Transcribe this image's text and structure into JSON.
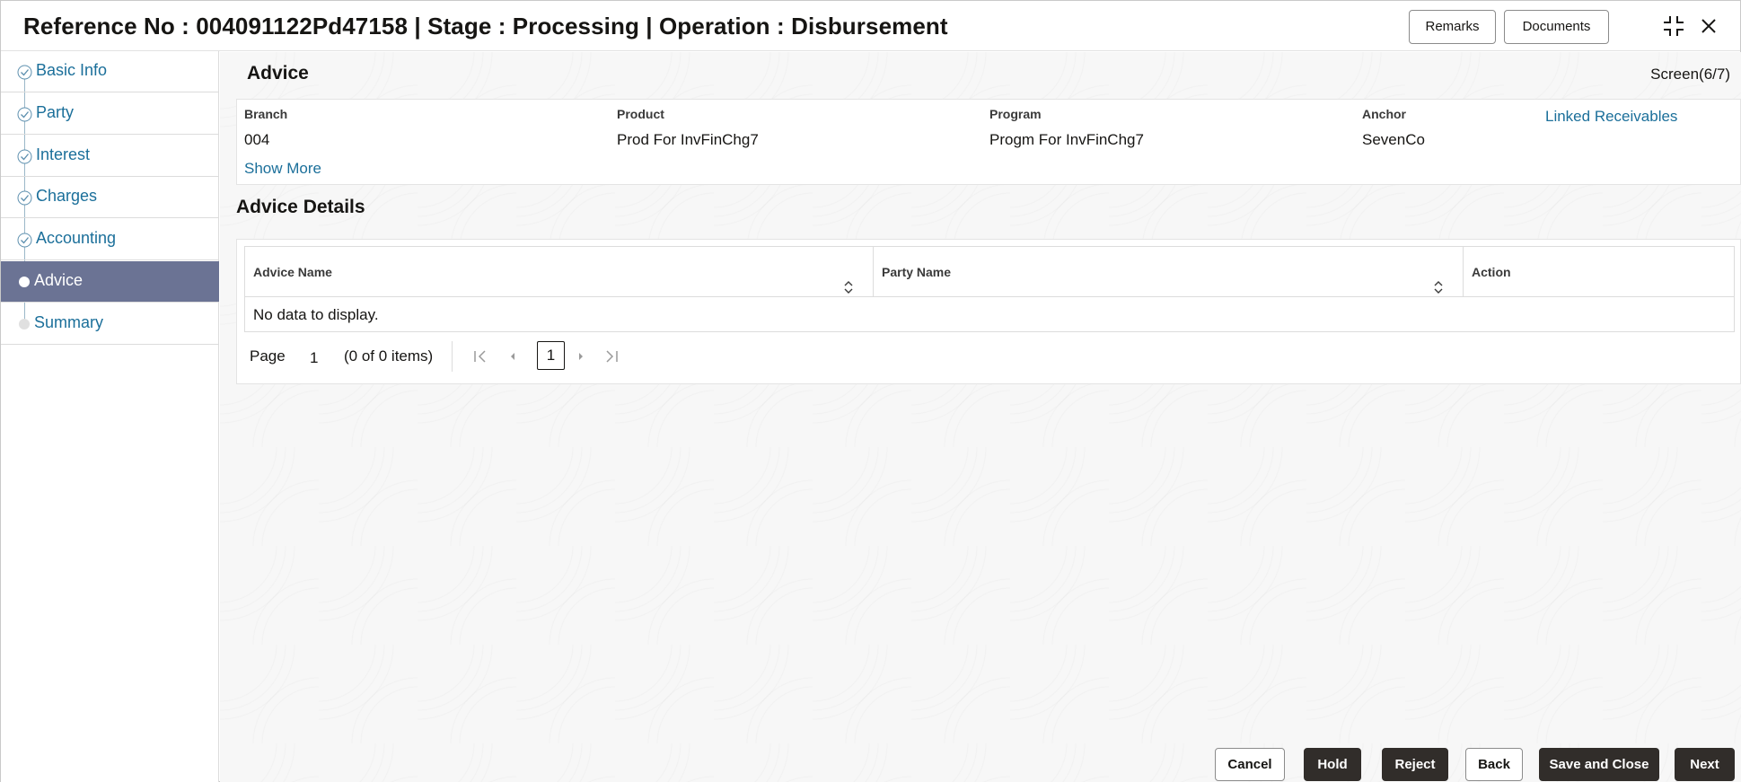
{
  "header": {
    "title": "Reference No : 004091122Pd47158 | Stage : Processing | Operation : Disbursement",
    "remarks_label": "Remarks",
    "documents_label": "Documents",
    "compress_icon": "compress-icon",
    "close_icon": "close-icon"
  },
  "sidebar": {
    "items": [
      {
        "label": "Basic Info",
        "state": "done"
      },
      {
        "label": "Party",
        "state": "done"
      },
      {
        "label": "Interest",
        "state": "done"
      },
      {
        "label": "Charges",
        "state": "done"
      },
      {
        "label": "Accounting",
        "state": "done"
      },
      {
        "label": "Advice",
        "state": "active"
      },
      {
        "label": "Summary",
        "state": "pending"
      }
    ],
    "active_color": "#6b7394"
  },
  "main": {
    "title": "Advice",
    "screen_count": "Screen(6/7)",
    "info": {
      "branch_label": "Branch",
      "branch_value": "004",
      "product_label": "Product",
      "product_value": "Prod For InvFinChg7",
      "program_label": "Program",
      "program_value": "Progm For InvFinChg7",
      "anchor_label": "Anchor",
      "anchor_value": "SevenCo",
      "linked_label": "Linked Receivables",
      "show_more": "Show More"
    },
    "details": {
      "title": "Advice Details",
      "columns": [
        "Advice Name",
        "Party Name",
        "Action"
      ],
      "empty_text": "No data to display.",
      "pager": {
        "page_label": "Page",
        "page_value": "1",
        "items_text": "(0 of 0 items)",
        "current_page": "1"
      }
    }
  },
  "footer": {
    "cancel": "Cancel",
    "hold": "Hold",
    "reject": "Reject",
    "back": "Back",
    "save_close": "Save and Close",
    "next": "Next"
  },
  "colors": {
    "link": "#1b6f9a",
    "dark_button": "#312d2a"
  }
}
